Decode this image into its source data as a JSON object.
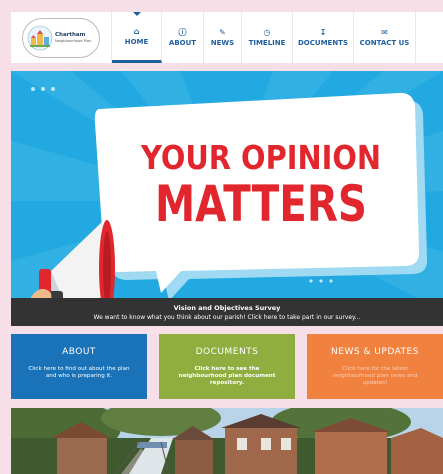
{
  "header": {
    "logo": {
      "name": "Chartham",
      "sub": "Neighbourhood Plan"
    },
    "nav": [
      {
        "label": "HOME",
        "icon": "home-icon",
        "active": true
      },
      {
        "label": "ABOUT",
        "icon": "info-icon"
      },
      {
        "label": "NEWS",
        "icon": "pencil-icon"
      },
      {
        "label": "TIMELINE",
        "icon": "clock-icon"
      },
      {
        "label": "DOCUMENTS",
        "icon": "download-icon"
      },
      {
        "label": "CONTACT US",
        "icon": "envelope-icon"
      }
    ]
  },
  "hero": {
    "headline_1": "YOUR OPINION",
    "headline_2": "MATTERS",
    "caption_title": "Vision and Objectives Survey",
    "caption_text": "We want to know what you think about our parish! Click here to take part in our survey..."
  },
  "tiles": [
    {
      "title": "ABOUT",
      "desc": "Click here to find out about the plan and who is preparing it.",
      "color": "#1a73b8"
    },
    {
      "title": "DOCUMENTS",
      "desc": "Click here to see the neighbourhood plan document repository.",
      "color": "#8fae3f"
    },
    {
      "title": "NEWS & UPDATES",
      "desc": "Click here for the latest neighbourhood plan news and updates!",
      "color": "#f0813f"
    }
  ],
  "colors": {
    "nav_blue": "#1f5f9e",
    "hero_blue": "#23a9e1",
    "headline_red": "#e1262d",
    "background_pink": "#f6dfe6"
  }
}
